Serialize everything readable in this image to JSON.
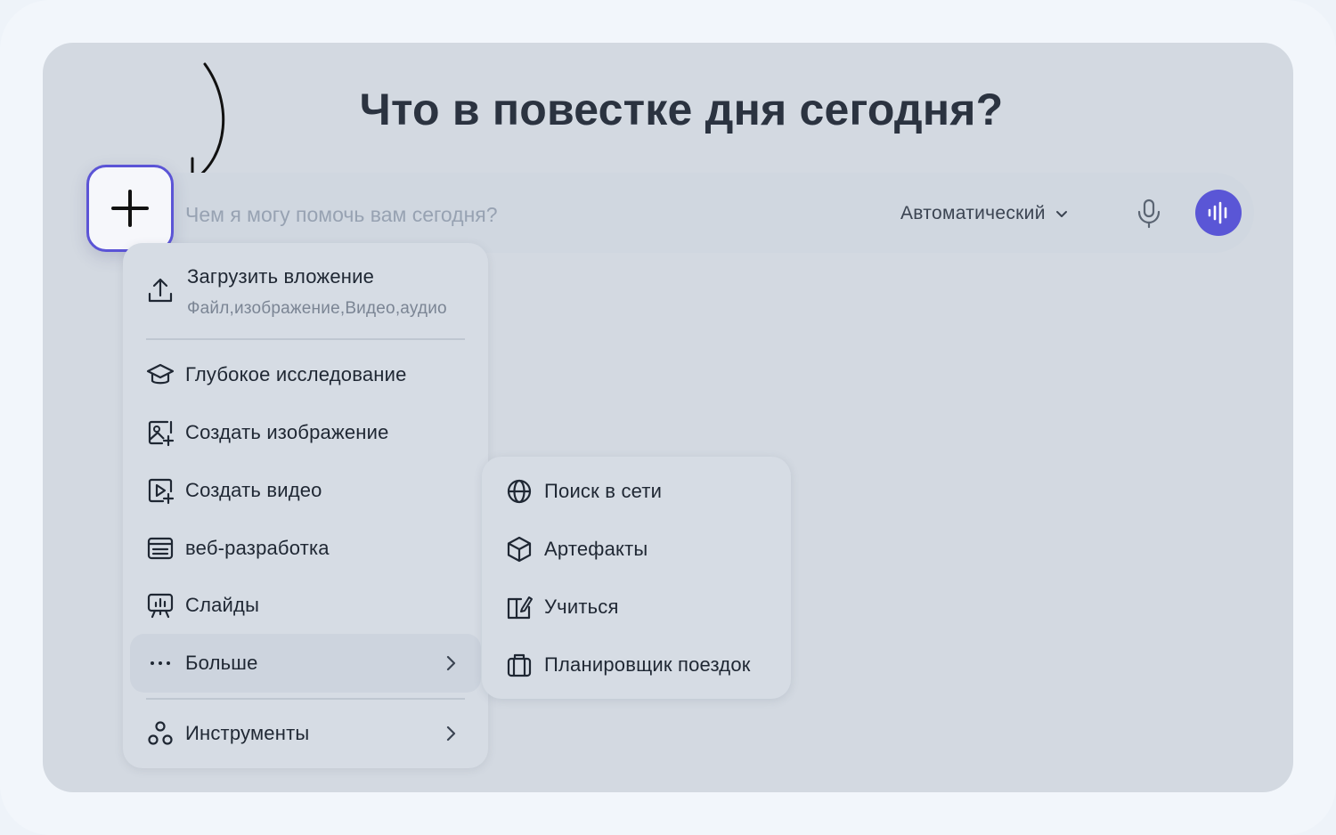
{
  "headline": "Что в повестке дня сегодня?",
  "composer": {
    "placeholder": "Чем я могу помочь вам сегодня?",
    "model": "Автоматический"
  },
  "menu": {
    "upload": {
      "title": "Загрузить вложение",
      "subtitle": "Файл,изображение,Видео,аудио"
    },
    "items": [
      {
        "label": "Глубокое исследование",
        "icon": "graduation-cap-icon"
      },
      {
        "label": "Создать изображение",
        "icon": "image-plus-icon"
      },
      {
        "label": "Создать видео",
        "icon": "video-plus-icon"
      },
      {
        "label": "веб-разработка",
        "icon": "browser-window-icon"
      },
      {
        "label": "Слайды",
        "icon": "presentation-icon"
      },
      {
        "label": "Больше",
        "icon": "ellipsis-icon"
      },
      {
        "label": "Инструменты",
        "icon": "shapes-icon"
      }
    ]
  },
  "submenu": {
    "items": [
      {
        "label": "Поиск в сети",
        "icon": "globe-icon"
      },
      {
        "label": "Артефакты",
        "icon": "cube-icon"
      },
      {
        "label": "Учиться",
        "icon": "book-edit-icon"
      },
      {
        "label": "Планировщик поездок",
        "icon": "suitcase-icon"
      }
    ]
  },
  "colors": {
    "accent": "#5a56d6",
    "panel": "#d3d9e1",
    "menu": "#d6dce4"
  }
}
